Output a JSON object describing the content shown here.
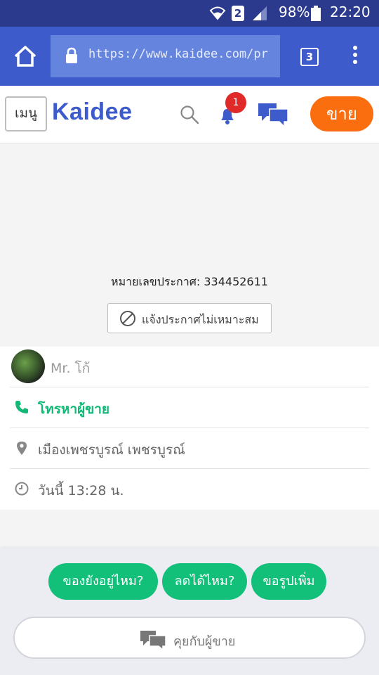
{
  "status_bar": {
    "sim_label": "2",
    "battery_text": "98%",
    "time": "22:20",
    "icons": [
      "wifi-icon",
      "sim-icon",
      "signal-icon",
      "battery-icon"
    ]
  },
  "browser": {
    "url": "https://www.kaidee.com/pr",
    "tab_count": "3",
    "toolbar_color": "#3e5bcb"
  },
  "site_header": {
    "menu_label": "เมนู",
    "logo": "Kaidee",
    "notification_count": "1",
    "sell_label": "ขาย",
    "brand_color": "#3e5bcb",
    "sell_color": "#fb6e10"
  },
  "ad_info": {
    "ad_number": "หมายเลขประกาศ: 334452611",
    "report_label": "แจ้งประกาศไม่เหมาะสม"
  },
  "seller": {
    "name": "Mr. โก้",
    "call_label": "โทรหาผู้ขาย",
    "location": "เมืองเพชรบูรณ์ เพชรบูรณ์",
    "posted_time": "วันนี้ 13:28 น."
  },
  "quick_replies": {
    "items": [
      "ของยังอยู่ไหม?",
      "ลดได้ไหม?",
      "ขอรูปเพิ่ม"
    ],
    "chip_color": "#12c07a",
    "chat_label": "คุยกับผู้ขาย"
  }
}
